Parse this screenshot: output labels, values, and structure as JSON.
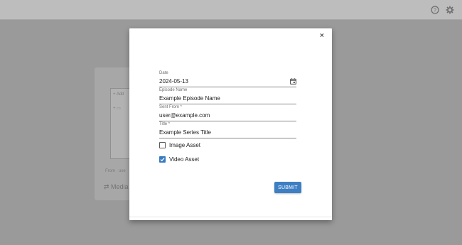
{
  "background": {
    "inner_lines": [
      "Add",
      ""
    ],
    "from_text": "From",
    "from_value": "use",
    "logo_text": "Media S"
  },
  "modal": {
    "close_symbol": "×",
    "date": {
      "label": "Date",
      "value": "2024-05-13"
    },
    "episode_name": {
      "label": "Episode Name",
      "value": "Example Episode Name"
    },
    "sent_from": {
      "label": "Sent From *",
      "value": "user@example.com"
    },
    "title": {
      "label": "Title *",
      "value": "Example Series Title"
    },
    "checkboxes": [
      {
        "label": "Image Asset",
        "checked": false
      },
      {
        "label": "Video Asset",
        "checked": true
      }
    ],
    "submit_label": "SUBMIT"
  },
  "colors": {
    "accent": "#3e7fc3",
    "overlay": "#9a9a9a"
  },
  "icons": {
    "help": "help-icon",
    "settings": "gear-icon",
    "calendar": "calendar-icon",
    "check": "check-icon"
  }
}
